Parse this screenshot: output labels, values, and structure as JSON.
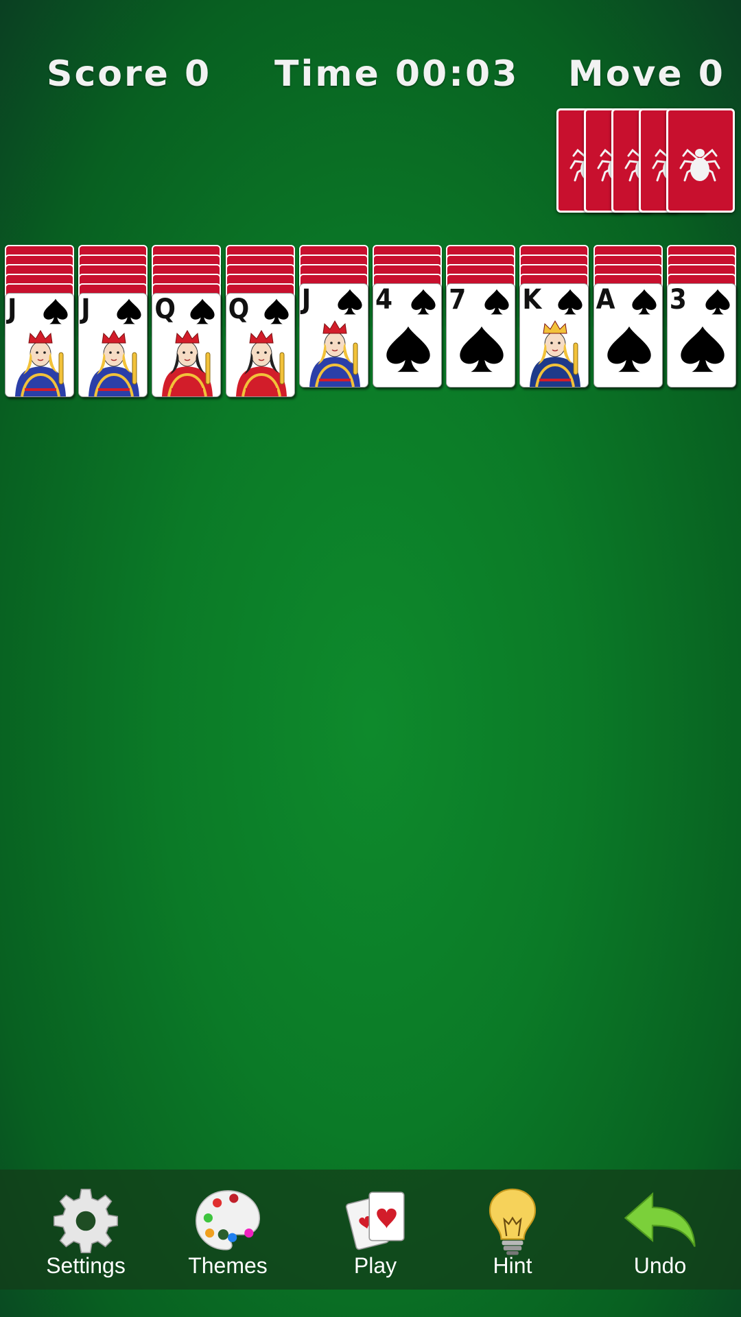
{
  "header": {
    "score": "Score 0",
    "time": "Time 00:03",
    "moves": "Move 0"
  },
  "stock": {
    "cards_remaining": 5,
    "back_color": "#c8102e"
  },
  "tableau": [
    {
      "face_down": 5,
      "rank": "J",
      "suit": "spades",
      "art": "jack-icon"
    },
    {
      "face_down": 5,
      "rank": "J",
      "suit": "spades",
      "art": "jack-icon"
    },
    {
      "face_down": 5,
      "rank": "Q",
      "suit": "spades",
      "art": "queen-icon"
    },
    {
      "face_down": 5,
      "rank": "Q",
      "suit": "spades",
      "art": "queen-icon"
    },
    {
      "face_down": 4,
      "rank": "J",
      "suit": "spades",
      "art": "jack-icon"
    },
    {
      "face_down": 4,
      "rank": "4",
      "suit": "spades",
      "art": "spade-icon"
    },
    {
      "face_down": 4,
      "rank": "7",
      "suit": "spades",
      "art": "spade-icon"
    },
    {
      "face_down": 4,
      "rank": "K",
      "suit": "spades",
      "art": "king-icon"
    },
    {
      "face_down": 4,
      "rank": "A",
      "suit": "spades",
      "art": "spade-icon"
    },
    {
      "face_down": 4,
      "rank": "3",
      "suit": "spades",
      "art": "spade-icon"
    }
  ],
  "toolbar": {
    "settings_label": "Settings",
    "themes_label": "Themes",
    "play_label": "Play",
    "hint_label": "Hint",
    "undo_label": "Undo"
  },
  "colors": {
    "felt": "#0b7a27",
    "card_back": "#c8102e",
    "undo_arrow": "#7bd03a",
    "hint_bulb": "#f2c23a"
  }
}
